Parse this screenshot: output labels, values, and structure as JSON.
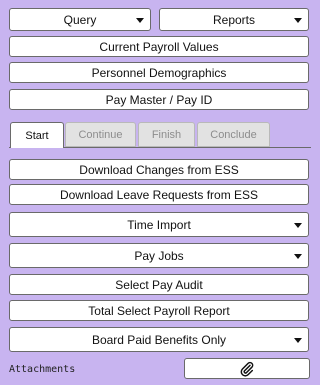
{
  "top_menus": {
    "query_label": "Query",
    "reports_label": "Reports"
  },
  "nav_buttons": {
    "current_payroll": "Current Payroll Values",
    "personnel_demographics": "Personnel Demographics",
    "pay_master": "Pay Master / Pay ID"
  },
  "tabs": [
    {
      "label": "Start",
      "active": true
    },
    {
      "label": "Continue",
      "active": false
    },
    {
      "label": "Finish",
      "active": false
    },
    {
      "label": "Conclude",
      "active": false
    }
  ],
  "actions": {
    "download_changes": "Download Changes from ESS",
    "download_leave": "Download Leave Requests from ESS",
    "time_import": "Time Import",
    "pay_jobs": "Pay Jobs",
    "select_pay_audit": "Select Pay Audit",
    "total_select_payroll": "Total Select Payroll Report",
    "board_paid_benefits": "Board Paid Benefits Only"
  },
  "attachments": {
    "label": "Attachments",
    "icon": "paperclip-icon"
  },
  "colors": {
    "background": "#c8b4f0",
    "button": "#ffffff",
    "border": "#6a6a6a"
  }
}
